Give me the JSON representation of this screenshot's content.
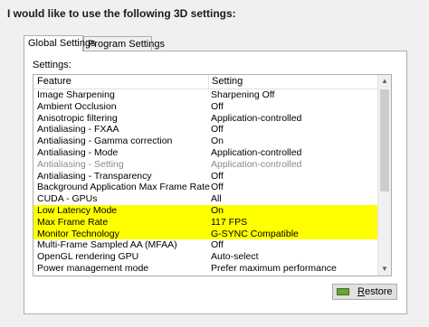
{
  "heading": "I would like to use the following 3D settings:",
  "tabs": [
    {
      "label": "Global Settings",
      "active": true
    },
    {
      "label": "Program Settings",
      "active": false
    }
  ],
  "settings_label": "Settings:",
  "columns": {
    "feature": "Feature",
    "setting": "Setting"
  },
  "rows": [
    {
      "feature": "Image Sharpening",
      "setting": "Sharpening Off"
    },
    {
      "feature": "Ambient Occlusion",
      "setting": "Off"
    },
    {
      "feature": "Anisotropic filtering",
      "setting": "Application-controlled"
    },
    {
      "feature": "Antialiasing - FXAA",
      "setting": "Off"
    },
    {
      "feature": "Antialiasing - Gamma correction",
      "setting": "On"
    },
    {
      "feature": "Antialiasing - Mode",
      "setting": "Application-controlled"
    },
    {
      "feature": "Antialiasing - Setting",
      "setting": "Application-controlled",
      "disabled": true
    },
    {
      "feature": "Antialiasing - Transparency",
      "setting": "Off"
    },
    {
      "feature": "Background Application Max Frame Rate",
      "setting": "Off"
    },
    {
      "feature": "CUDA - GPUs",
      "setting": "All"
    },
    {
      "feature": "Low Latency Mode",
      "setting": "On",
      "highlighted": true
    },
    {
      "feature": "Max Frame Rate",
      "setting": "117 FPS",
      "highlighted": true
    },
    {
      "feature": "Monitor Technology",
      "setting": "G-SYNC Compatible",
      "highlighted": true
    },
    {
      "feature": "Multi-Frame Sampled AA (MFAA)",
      "setting": "Off"
    },
    {
      "feature": "OpenGL rendering GPU",
      "setting": "Auto-select"
    },
    {
      "feature": "Power management mode",
      "setting": "Prefer maximum performance"
    }
  ],
  "restore_button": {
    "label": "Restore",
    "accesskey_letter": "R",
    "label_rest": "estore"
  },
  "colors": {
    "highlight": "#ffff00",
    "disabled_text": "#8a8a8a"
  }
}
